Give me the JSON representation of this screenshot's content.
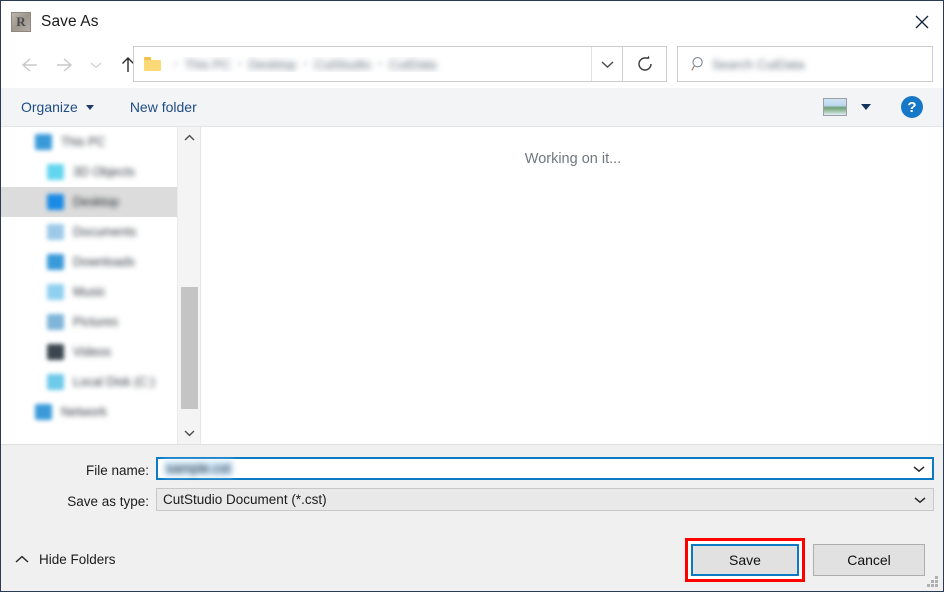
{
  "window": {
    "title": "Save As",
    "app_icon": "cutstudio-icon",
    "icon_letter": "R",
    "close_label": "✕"
  },
  "nav": {
    "back": "back-arrow",
    "forward": "forward-arrow",
    "recent": "recent-locations-chevron",
    "up": "up-arrow",
    "refresh": "refresh-icon"
  },
  "address": {
    "folder_icon": "folder-icon",
    "crumbs": [
      "This PC",
      "Desktop",
      "CutStudio",
      "CutData"
    ],
    "separator": "›",
    "dropdown": "chevron-down-icon"
  },
  "search": {
    "icon": "search-icon",
    "placeholder": "Search CutData"
  },
  "toolbar": {
    "organize_label": "Organize",
    "new_folder_label": "New folder",
    "view_icon": "view-layout-icon",
    "view_dropdown": "chevron-down-icon",
    "help_label": "?"
  },
  "tree": {
    "items": [
      {
        "label": "This PC",
        "indent": false,
        "selected": false,
        "color": "#3a9ad9"
      },
      {
        "label": "3D Objects",
        "indent": true,
        "selected": false,
        "color": "#63d6ef"
      },
      {
        "label": "Desktop",
        "indent": true,
        "selected": true,
        "color": "#1a8ae5"
      },
      {
        "label": "Documents",
        "indent": true,
        "selected": false,
        "color": "#9cc9e8"
      },
      {
        "label": "Downloads",
        "indent": true,
        "selected": false,
        "color": "#3a9ad9"
      },
      {
        "label": "Music",
        "indent": true,
        "selected": false,
        "color": "#8fd0f0"
      },
      {
        "label": "Pictures",
        "indent": true,
        "selected": false,
        "color": "#7fb5d8"
      },
      {
        "label": "Videos",
        "indent": true,
        "selected": false,
        "color": "#3b4650"
      },
      {
        "label": "Local Disk (C:)",
        "indent": true,
        "selected": false,
        "color": "#6ec9ea"
      },
      {
        "label": "Network",
        "indent": false,
        "selected": false,
        "color": "#3a9ad9"
      }
    ],
    "scrollbar": {
      "up_arrow": "chevron-up-icon",
      "down_arrow": "chevron-down-icon"
    }
  },
  "file_list": {
    "status_text": "Working on it..."
  },
  "fields": {
    "file_name_label": "File name:",
    "file_name_value": "sample.cst",
    "save_as_type_label": "Save as type:",
    "save_as_type_value": "CutStudio Document (*.cst)",
    "dropdown_icon": "chevron-down-icon"
  },
  "buttons": {
    "save_label": "Save",
    "cancel_label": "Cancel",
    "hide_folders_label": "Hide Folders",
    "hide_folders_icon": "chevron-up-icon"
  },
  "colors": {
    "focus_blue": "#0d7bc4",
    "highlight_red": "#ff0000",
    "accent_link": "#1f4c85",
    "help_blue": "#1878c8",
    "selection_blue": "#cde8fb"
  }
}
